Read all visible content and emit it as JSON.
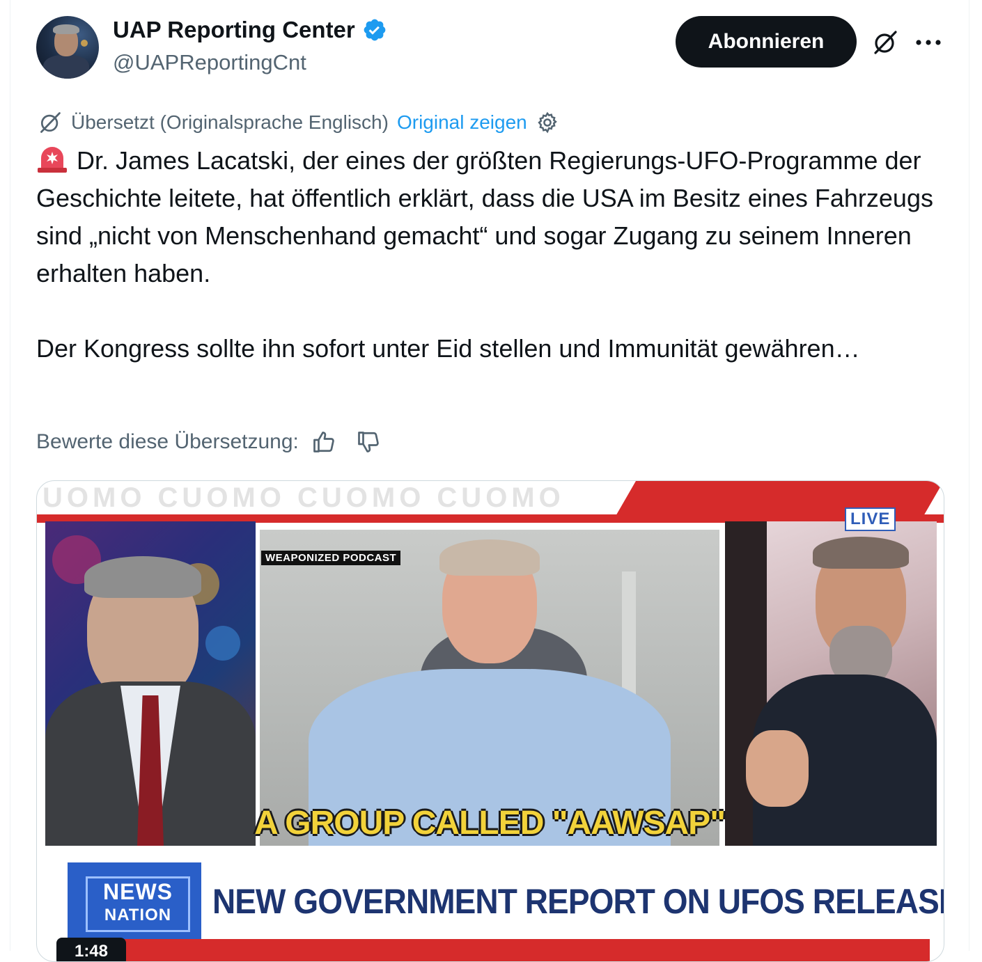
{
  "account": {
    "display_name": "UAP Reporting Center",
    "handle": "@UAPReportingCnt",
    "verified": true,
    "verified_color": "#1d9bf0"
  },
  "actions": {
    "follow_label": "Abonnieren",
    "grok_icon": "grok-icon",
    "more_icon": "more-icon"
  },
  "translation": {
    "label": "Übersetzt (Originalsprache Englisch)",
    "show_original": "Original zeigen",
    "settings_icon": "gear-icon"
  },
  "tweet": {
    "emoji": "rotating-light-emoji",
    "paragraph1": "Dr. James Lacatski, der eines der größten Regierungs-UFO-Programme der Geschichte leitete, hat öffentlich erklärt, dass die USA im Besitz eines Fahrzeugs sind „nicht von Menschenhand gemacht“ und sogar Zugang zu seinem Inneren erhalten haben.",
    "paragraph2": "Der Kongress sollte ihn sofort unter Eid stellen und Immunität gewähren…"
  },
  "rating": {
    "label": "Bewerte diese Übersetzung:",
    "up_icon": "thumbs-up-icon",
    "down_icon": "thumbs-down-icon"
  },
  "video": {
    "watermark": "UOMO CUOMO CUOMO CUOMO",
    "podcast_tag": "WEAPONIZED PODCAST",
    "live_badge": "LIVE",
    "caption": "A GROUP CALLED \"AAWSAP\"",
    "logo_line1": "NEWS",
    "logo_line2": "NATION",
    "headline": "NEW GOVERNMENT REPORT ON UFOS RELEASED",
    "duration": "1:48"
  },
  "colors": {
    "accent": "#1d9bf0",
    "text_primary": "#0f1419",
    "text_secondary": "#536471",
    "news_red": "#d62b2b",
    "news_blue": "#2a5fc8",
    "caption_yellow": "#f2d23a"
  }
}
